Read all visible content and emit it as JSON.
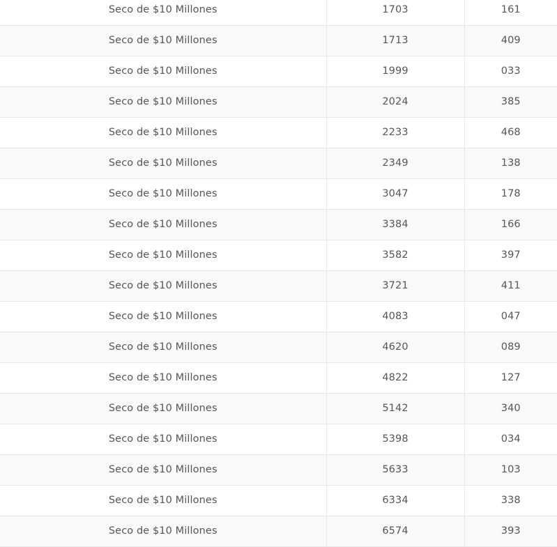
{
  "results_table": {
    "rows": [
      {
        "prize": "Seco de $10 Millones",
        "number": "1703",
        "series": "161"
      },
      {
        "prize": "Seco de $10 Millones",
        "number": "1713",
        "series": "409"
      },
      {
        "prize": "Seco de $10 Millones",
        "number": "1999",
        "series": "033"
      },
      {
        "prize": "Seco de $10 Millones",
        "number": "2024",
        "series": "385"
      },
      {
        "prize": "Seco de $10 Millones",
        "number": "2233",
        "series": "468"
      },
      {
        "prize": "Seco de $10 Millones",
        "number": "2349",
        "series": "138"
      },
      {
        "prize": "Seco de $10 Millones",
        "number": "3047",
        "series": "178"
      },
      {
        "prize": "Seco de $10 Millones",
        "number": "3384",
        "series": "166"
      },
      {
        "prize": "Seco de $10 Millones",
        "number": "3582",
        "series": "397"
      },
      {
        "prize": "Seco de $10 Millones",
        "number": "3721",
        "series": "411"
      },
      {
        "prize": "Seco de $10 Millones",
        "number": "4083",
        "series": "047"
      },
      {
        "prize": "Seco de $10 Millones",
        "number": "4620",
        "series": "089"
      },
      {
        "prize": "Seco de $10 Millones",
        "number": "4822",
        "series": "127"
      },
      {
        "prize": "Seco de $10 Millones",
        "number": "5142",
        "series": "340"
      },
      {
        "prize": "Seco de $10 Millones",
        "number": "5398",
        "series": "034"
      },
      {
        "prize": "Seco de $10 Millones",
        "number": "5633",
        "series": "103"
      },
      {
        "prize": "Seco de $10 Millones",
        "number": "6334",
        "series": "338"
      },
      {
        "prize": "Seco de $10 Millones",
        "number": "6574",
        "series": "393"
      }
    ]
  }
}
